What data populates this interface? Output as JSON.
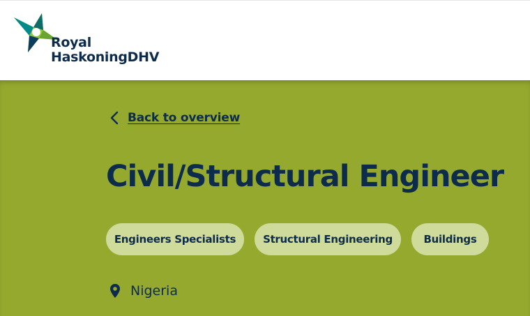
{
  "brand": {
    "line1": "Royal",
    "line2": "HaskoningDHV"
  },
  "nav": {
    "back_label": "Back to overview"
  },
  "job": {
    "title": "Civil/Structural Engineer",
    "tags": [
      "Engineers Specialists",
      "Structural Engineering",
      "Buildings"
    ],
    "location": "Nigeria"
  },
  "icons": {
    "logo": "star-logo-icon",
    "back": "chevron-left-icon",
    "location": "map-pin-icon"
  },
  "colors": {
    "hero_background": "#95a92f",
    "tag_background": "#cfdb9a",
    "text_dark": "#0d2b4a",
    "logo_green": "#8cc63f",
    "logo_teal": "#008a8a"
  }
}
